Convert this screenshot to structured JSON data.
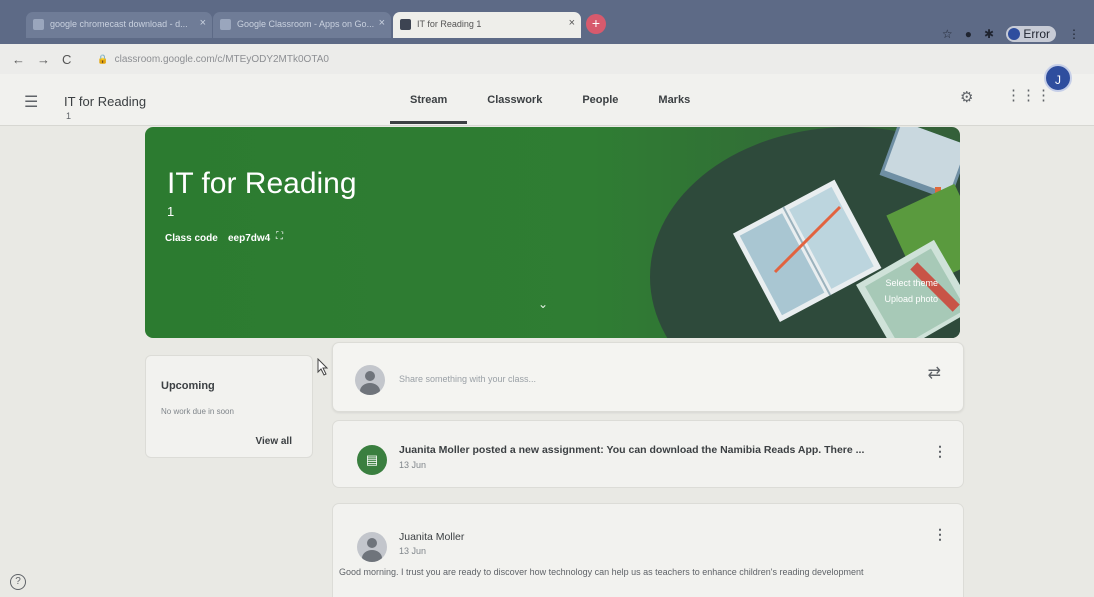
{
  "browser": {
    "tabs": [
      {
        "title": "google chromecast download - d...",
        "active": false
      },
      {
        "title": "Google Classroom - Apps on Go...",
        "active": false
      },
      {
        "title": "IT for Reading 1",
        "active": true
      }
    ],
    "new_tab_icon": "+",
    "url": "classroom.google.com/c/MTEyODY2MTk0OTA0",
    "profile_label": "Error",
    "toolbar_icons": [
      "star-icon",
      "extension-icon",
      "puzzle-icon"
    ]
  },
  "appbar": {
    "class_name": "IT for Reading",
    "class_section": "1",
    "tabs": [
      "Stream",
      "Classwork",
      "People",
      "Marks"
    ],
    "active_tab": "Stream",
    "user_initial": "J"
  },
  "banner": {
    "title": "IT for Reading",
    "section": "1",
    "class_code_label": "Class code",
    "class_code": "eep7dw4",
    "select_theme": "Select theme",
    "upload_photo": "Upload photo",
    "color": "#2f7d33"
  },
  "upcoming": {
    "title": "Upcoming",
    "empty_text": "No work due in soon",
    "view_all": "View all"
  },
  "share": {
    "placeholder": "Share something with your class..."
  },
  "posts": [
    {
      "text": "Juanita Moller posted a new assignment: You can download the Namibia Reads App. There ...",
      "date": "13 Jun",
      "icon": "assignment-icon"
    },
    {
      "author": "Juanita Moller",
      "date": "13 Jun",
      "body": "Good morning. I trust you are ready to discover how technology can help us as teachers to enhance children's reading development"
    }
  ]
}
